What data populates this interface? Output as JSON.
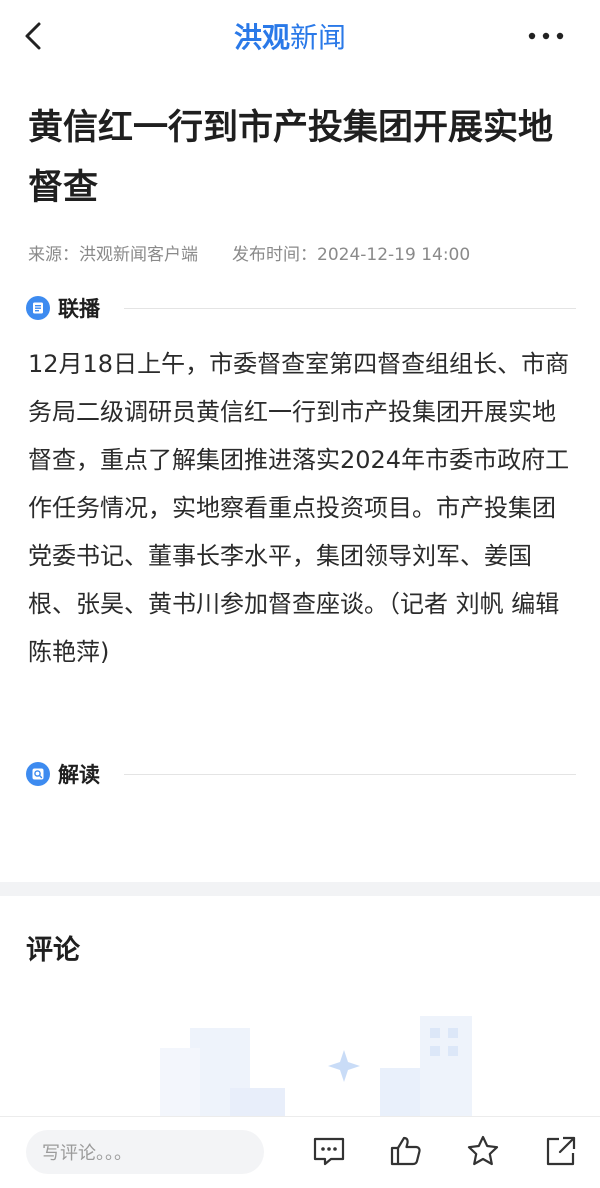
{
  "header": {
    "brand_part1": "洪观",
    "brand_part2": "新闻"
  },
  "article": {
    "title": "黄信红一行到市产投集团开展实地督查",
    "source": "来源：洪观新闻客户端",
    "publish_time": "发布时间：2024-12-19 14:00",
    "section_broadcast": "联播",
    "body": "12月18日上午，市委督查室第四督查组组长、市商务局二级调研员黄信红一行到市产投集团开展实地督查，重点了解集团推进落实2024年市委市政府工作任务情况，实地察看重点投资项目。市产投集团党委书记、董事长李水平，集团领导刘军、姜国根、张昊、黄书川参加督查座谈。（记者 刘帆 编辑 陈艳萍)",
    "section_interpret": "解读"
  },
  "comments": {
    "title": "评论"
  },
  "bottom_bar": {
    "comment_placeholder": "写评论。。。"
  },
  "colors": {
    "accent": "#2a79e8",
    "section_icon": "#3d8bf0"
  },
  "icons": [
    "chevron-left-icon",
    "more-dots-icon",
    "broadcast-icon",
    "interpret-icon",
    "comment-bubble-icon",
    "thumbs-up-icon",
    "star-icon",
    "share-icon"
  ]
}
